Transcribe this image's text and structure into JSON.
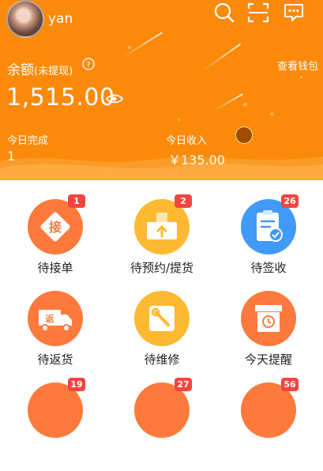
{
  "header": {
    "username": "yan",
    "balance_label": "余额",
    "balance_sublabel": "(未提现)",
    "wallet_link": "查看钱包",
    "balance": "1,515.00",
    "today_done_label": "今日完成",
    "today_done_value": "1",
    "today_income_label": "今日收入",
    "today_income_value": "￥135.00",
    "icons": [
      "search-icon",
      "scan-icon",
      "message-icon",
      "help-icon",
      "eye-icon"
    ]
  },
  "tiles": [
    {
      "label": "待接单",
      "badge": "1",
      "icon": "accept-order-icon",
      "color": "#fd7a3c"
    },
    {
      "label": "待预约/提货",
      "badge": "2",
      "icon": "pickup-boxes-icon",
      "color": "#fdb931"
    },
    {
      "label": "待签收",
      "badge": "26",
      "icon": "sign-clipboard-icon",
      "color": "#3f9af8"
    },
    {
      "label": "待返货",
      "badge": "",
      "icon": "return-truck-icon",
      "color": "#fd7a3c"
    },
    {
      "label": "待维修",
      "badge": "",
      "icon": "repair-wrench-icon",
      "color": "#fdb931"
    },
    {
      "label": "今天提醒",
      "badge": "",
      "icon": "reminder-box-icon",
      "color": "#fd7a3c"
    },
    {
      "label": "",
      "badge": "19",
      "icon": "",
      "color": "#fd7a3c"
    },
    {
      "label": "",
      "badge": "27",
      "icon": "",
      "color": "#fd7a3c"
    },
    {
      "label": "",
      "badge": "56",
      "icon": "",
      "color": "#fd7a3c"
    }
  ]
}
